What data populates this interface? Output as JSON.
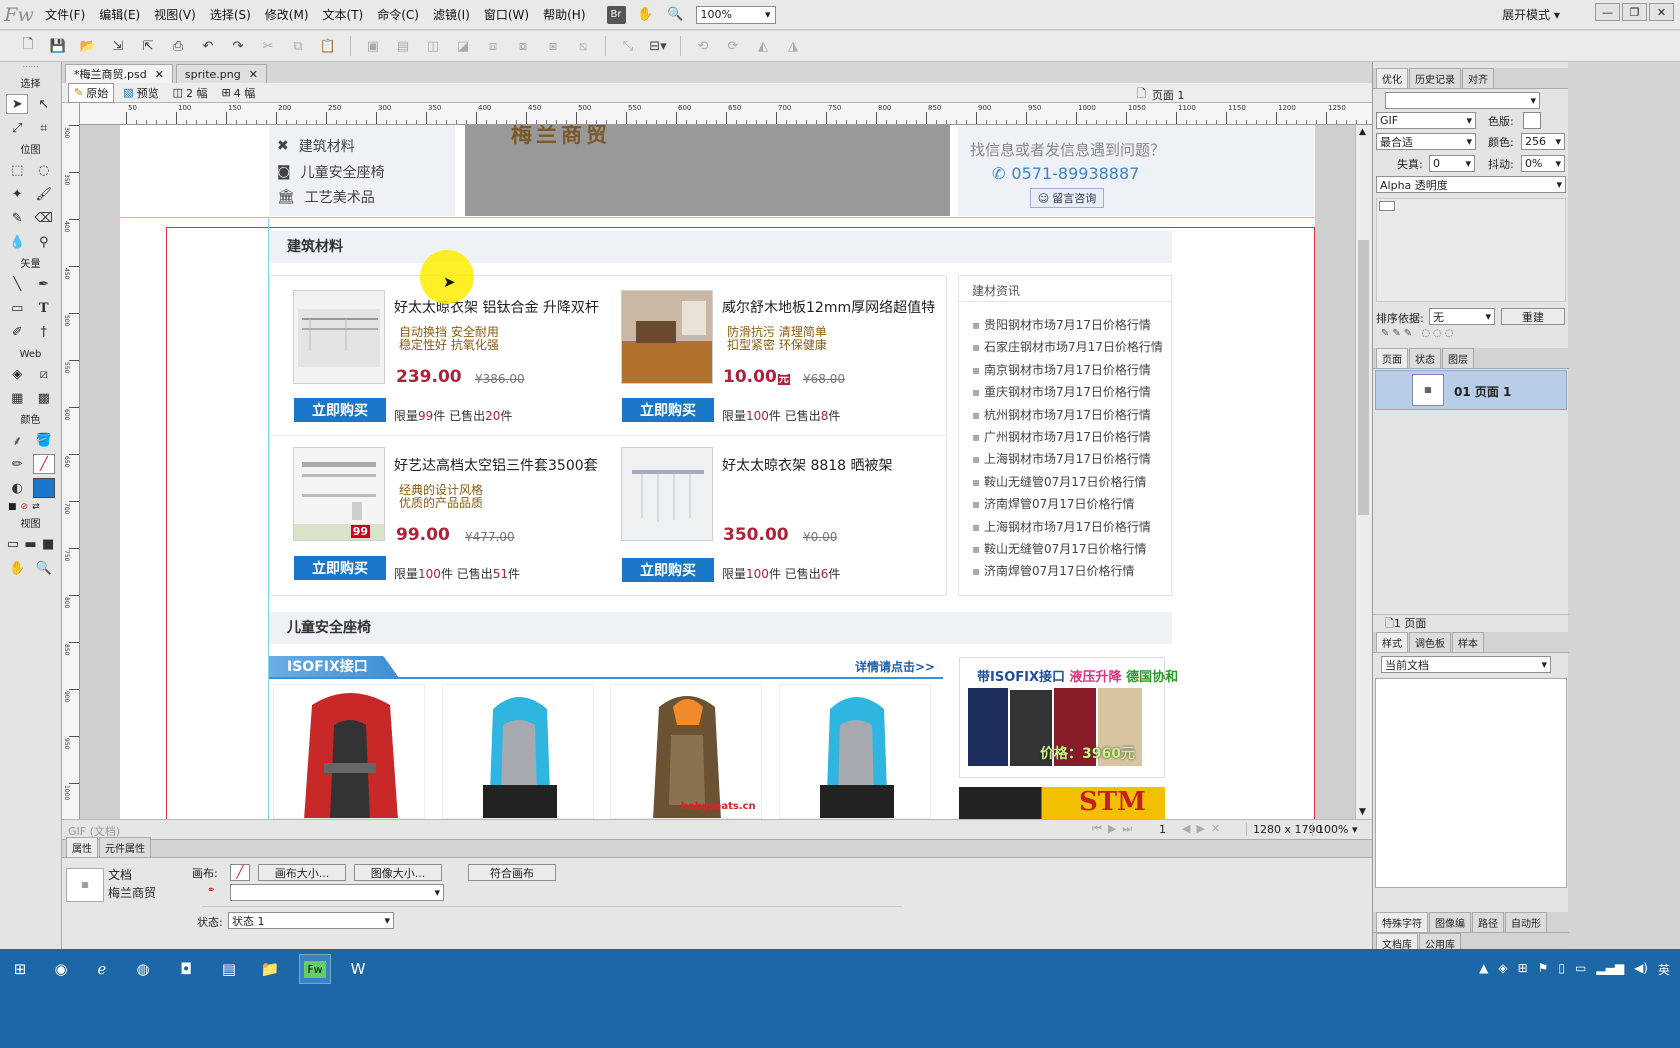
{
  "app": {
    "logo": "Fw",
    "menus": [
      "文件(F)",
      "编辑(E)",
      "视图(V)",
      "选择(S)",
      "修改(M)",
      "文本(T)",
      "命令(C)",
      "滤镜(I)",
      "窗口(W)",
      "帮助(H)"
    ],
    "bridge": "Br",
    "zoom": "100%",
    "workspace": "展开模式"
  },
  "tools": {
    "select": "选择",
    "bitmap": "位图",
    "vector": "矢量",
    "web": "Web",
    "colors": "颜色",
    "view": "视图"
  },
  "tabs": [
    {
      "label": "*梅兰商贸.psd"
    },
    {
      "label": "sprite.png"
    }
  ],
  "views": {
    "original": "原始",
    "preview": "预览",
    "two": "2 幅",
    "four": "4 幅",
    "page": "页面 1"
  },
  "ruler": {
    "top": [
      "50",
      "100",
      "150",
      "200",
      "250",
      "300",
      "350",
      "400",
      "450",
      "500",
      "550",
      "600",
      "650",
      "700",
      "750",
      "800",
      "850",
      "900",
      "950",
      "1000",
      "1050",
      "1100",
      "1150",
      "1200",
      "1250"
    ],
    "left": [
      "300",
      "350",
      "400",
      "450",
      "500",
      "550",
      "600",
      "650",
      "700",
      "750",
      "800",
      "850",
      "900",
      "950",
      "1000"
    ]
  },
  "doc": {
    "side_items": [
      "建筑材料",
      "儿童安全座椅",
      "工艺美术品"
    ],
    "banner_text": "梅兰商贸",
    "help": {
      "question": "找信息或者发信息遇到问题？",
      "phone": "0571-89938887",
      "consult": "留言咨询"
    },
    "section1": "建筑材料",
    "products": [
      {
        "title": "好太太晾衣架 铝钛合金 升降双杆",
        "desc1": "自动换挡  安全耐用",
        "desc2": "稳定性好  抗氧化强",
        "price": "239.00",
        "old": "¥386.00",
        "buy": "立即购买",
        "limit_pre": "限量",
        "limit": "99",
        "limit_mid": "件  已售出",
        "sold": "20",
        "limit_post": "件"
      },
      {
        "title": "威尔舒木地板12mm厚网络超值特",
        "desc1": "防滑抗污  清理简单",
        "desc2": "扣型紧密  环保健康",
        "price": "10.00",
        "old": "¥68.00",
        "buy": "立即购买",
        "limit_pre": "限量",
        "limit": "100",
        "limit_mid": "件  已售出",
        "sold": "8",
        "limit_post": "件"
      },
      {
        "title": "好艺达高档太空铝三件套3500套",
        "desc1": "经典的设计风格",
        "desc2": "优质的产品品质",
        "price": "99.00",
        "old": "¥477.00",
        "buy": "立即购买",
        "limit_pre": "限量",
        "limit": "100",
        "limit_mid": "件  已售出",
        "sold": "51",
        "limit_post": "件"
      },
      {
        "title": "好太太晾衣架 8818 晒被架",
        "desc1": "",
        "desc2": "",
        "price": "350.00",
        "old": "¥0.00",
        "buy": "立即购买",
        "limit_pre": "限量",
        "limit": "100",
        "limit_mid": "件  已售出",
        "sold": "6",
        "limit_post": "件"
      }
    ],
    "img_badge": "99",
    "price_suffix": "元",
    "news_title": "建材资讯",
    "news": [
      "贵阳钢材市场7月17日价格行情",
      "石家庄钢材市场7月17日价格行情",
      "南京钢材市场7月17日价格行情",
      "重庆钢材市场7月17日价格行情",
      "杭州钢材市场7月17日价格行情",
      "广州钢材市场7月17日价格行情",
      "上海钢材市场7月17日价格行情",
      "鞍山无缝管07月17日价格行情",
      "济南焊管07月17日价格行情",
      "上海钢材市场7月17日价格行情",
      "鞍山无缝管07月17日价格行情",
      "济南焊管07月17日价格行情"
    ],
    "section2": "儿童安全座椅",
    "isofix": "ISOFIX接口",
    "details": "详情请点击>>",
    "seat_brand": "babyseats.cn",
    "ad": {
      "t1": "带ISOFIX接口",
      "t2": "液压升降",
      "t3": "德国协和",
      "price": "价格：3960元",
      "stm": "STM"
    }
  },
  "status": {
    "format": "GIF (文档)",
    "frame": "1",
    "size": "1280 x 1790",
    "zoom": "100%"
  },
  "right": {
    "tabs1": [
      "优化",
      "历史记录",
      "对齐"
    ],
    "format": "GIF",
    "palette_label": "色版:",
    "fit": "最合适",
    "colors_label": "颜色:",
    "colors": "256",
    "loss_label": "失真:",
    "loss": "0",
    "dither_label": "抖动:",
    "dither": "0%",
    "alpha": "Alpha 透明度",
    "sort_label": "排序依据:",
    "sort": "无",
    "rebuild": "重建",
    "tabs2": [
      "页面",
      "状态",
      "图层"
    ],
    "page_item": "01 页面 1",
    "page_count": "1 页面",
    "tabs3": [
      "样式",
      "调色板",
      "样本"
    ],
    "style_doc": "当前文档",
    "tabs4": [
      "特殊字符",
      "图像编",
      "路径",
      "自动形"
    ],
    "tabs5": [
      "文档库",
      "公用库"
    ]
  },
  "props": {
    "tab1": "属性",
    "tab2": "元件属性",
    "doc_label": "文档",
    "doc_name": "梅兰商贸",
    "canvas_label": "画布:",
    "canvas_size": "画布大小...",
    "image_size": "图像大小...",
    "fit_canvas": "符合画布",
    "state_label": "状态:",
    "state": "状态 1"
  },
  "taskbar": {
    "lang": "英"
  },
  "colors": {
    "accent": "#1a77c9",
    "price": "#b0213a",
    "taskbar": "#1c67a8"
  }
}
